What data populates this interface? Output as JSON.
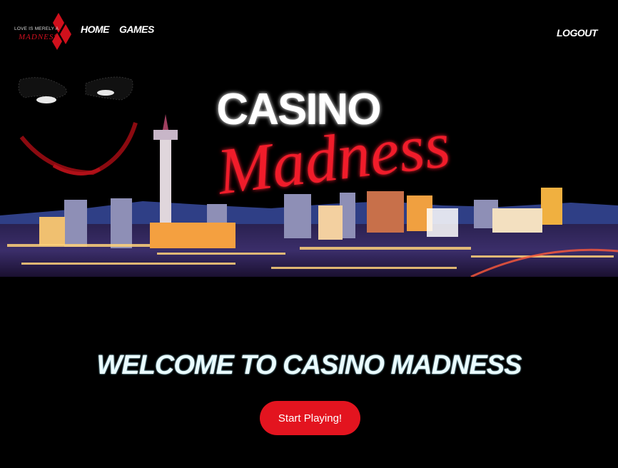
{
  "nav": {
    "logo_line1": "LOVE IS MERELY A",
    "logo_line2": "MADNESS",
    "links": [
      {
        "label": "Home"
      },
      {
        "label": "Games"
      }
    ],
    "logout_label": "Logout"
  },
  "hero": {
    "sign_line1": "CASINO",
    "sign_line2": "Madness"
  },
  "main": {
    "welcome": "Welcome to Casino Madness",
    "cta_label": "Start Playing!"
  },
  "colors": {
    "background": "#000000",
    "accent_red": "#e3141f",
    "welcome_text": "#eafcff"
  }
}
